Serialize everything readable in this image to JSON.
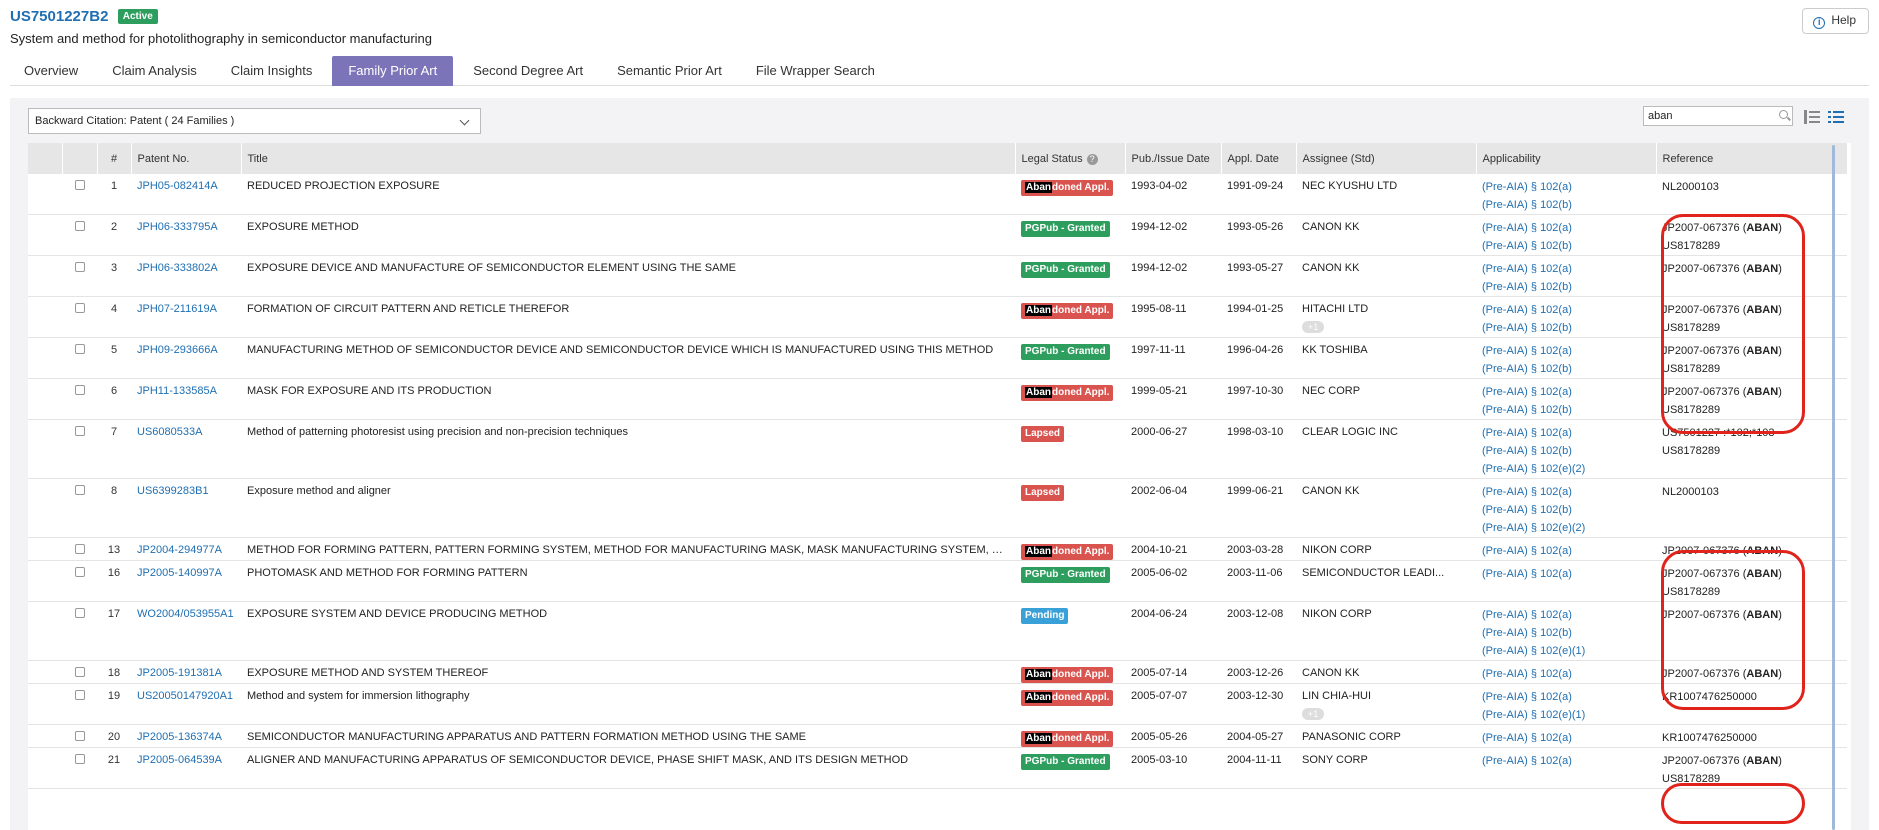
{
  "header": {
    "patent_id": "US7501227B2",
    "status": "Active",
    "title": "System and method for photolithography in semiconductor manufacturing",
    "help_label": "Help"
  },
  "tabs": [
    {
      "label": "Overview",
      "active": false
    },
    {
      "label": "Claim Analysis",
      "active": false
    },
    {
      "label": "Claim Insights",
      "active": false
    },
    {
      "label": "Family Prior Art",
      "active": true
    },
    {
      "label": "Second Degree Art",
      "active": false
    },
    {
      "label": "Semantic Prior Art",
      "active": false
    },
    {
      "label": "File Wrapper Search",
      "active": false
    }
  ],
  "filter": {
    "citation_select": "Backward Citation: Patent ( 24 Families )",
    "search_value": "aban"
  },
  "table": {
    "columns": [
      "#",
      "Patent No.",
      "Title",
      "Legal Status",
      "Pub./Issue Date",
      "Appl. Date",
      "Assignee (Std)",
      "Applicability",
      "Reference"
    ],
    "rows": [
      {
        "num": "1",
        "patent": "JPH05-082414A",
        "title": "REDUCED PROJECTION EXPOSURE",
        "status_type": "aban",
        "status_pre": "Aban",
        "status_post": "doned Appl.",
        "pub": "1993-04-02",
        "appl": "1991-09-24",
        "assignee": "NEC KYUSHU LTD",
        "plus": "",
        "applic": [
          "(Pre-AIA) § 102(a)",
          "(Pre-AIA) § 102(b)"
        ],
        "ref": [
          {
            "pre": "NL2000103",
            "bold": "",
            "post": ""
          }
        ]
      },
      {
        "num": "2",
        "patent": "JPH06-333795A",
        "title": "EXPOSURE METHOD",
        "status_type": "granted",
        "status_pre": "",
        "status_post": "PGPub - Granted",
        "pub": "1994-12-02",
        "appl": "1993-05-26",
        "assignee": "CANON KK",
        "plus": "",
        "applic": [
          "(Pre-AIA) § 102(a)",
          "(Pre-AIA) § 102(b)"
        ],
        "ref": [
          {
            "pre": "JP2007-067376 (",
            "bold": "ABAN",
            "post": ")"
          },
          {
            "pre": "US8178289",
            "bold": "",
            "post": ""
          }
        ]
      },
      {
        "num": "3",
        "patent": "JPH06-333802A",
        "title": "EXPOSURE DEVICE AND MANUFACTURE OF SEMICONDUCTOR ELEMENT USING THE SAME",
        "status_type": "granted",
        "status_pre": "",
        "status_post": "PGPub - Granted",
        "pub": "1994-12-02",
        "appl": "1993-05-27",
        "assignee": "CANON KK",
        "plus": "",
        "applic": [
          "(Pre-AIA) § 102(a)",
          "(Pre-AIA) § 102(b)"
        ],
        "ref": [
          {
            "pre": "JP2007-067376 (",
            "bold": "ABAN",
            "post": ")"
          }
        ]
      },
      {
        "num": "4",
        "patent": "JPH07-211619A",
        "title": "FORMATION OF CIRCUIT PATTERN AND RETICLE THEREFOR",
        "status_type": "aban",
        "status_pre": "Aban",
        "status_post": "doned Appl.",
        "pub": "1995-08-11",
        "appl": "1994-01-25",
        "assignee": "HITACHI LTD",
        "plus": "+1",
        "applic": [
          "(Pre-AIA) § 102(a)",
          "(Pre-AIA) § 102(b)"
        ],
        "ref": [
          {
            "pre": "JP2007-067376 (",
            "bold": "ABAN",
            "post": ")"
          },
          {
            "pre": "US8178289",
            "bold": "",
            "post": ""
          }
        ]
      },
      {
        "num": "5",
        "patent": "JPH09-293666A",
        "title": "MANUFACTURING METHOD OF SEMICONDUCTOR DEVICE AND SEMICONDUCTOR DEVICE WHICH IS MANUFACTURED USING THIS METHOD",
        "status_type": "granted",
        "status_pre": "",
        "status_post": "PGPub - Granted",
        "pub": "1997-11-11",
        "appl": "1996-04-26",
        "assignee": "KK TOSHIBA",
        "plus": "",
        "applic": [
          "(Pre-AIA) § 102(a)",
          "(Pre-AIA) § 102(b)"
        ],
        "ref": [
          {
            "pre": "JP2007-067376 (",
            "bold": "ABAN",
            "post": ")"
          },
          {
            "pre": "US8178289",
            "bold": "",
            "post": ""
          }
        ]
      },
      {
        "num": "6",
        "patent": "JPH11-133585A",
        "title": "MASK FOR EXPOSURE AND ITS PRODUCTION",
        "status_type": "aban",
        "status_pre": "Aban",
        "status_post": "doned Appl.",
        "pub": "1999-05-21",
        "appl": "1997-10-30",
        "assignee": "NEC CORP",
        "plus": "",
        "applic": [
          "(Pre-AIA) § 102(a)",
          "(Pre-AIA) § 102(b)"
        ],
        "ref": [
          {
            "pre": "JP2007-067376 (",
            "bold": "ABAN",
            "post": ")"
          },
          {
            "pre": "US8178289",
            "bold": "",
            "post": ""
          }
        ]
      },
      {
        "num": "7",
        "patent": "US6080533A",
        "title": "Method of patterning photoresist using precision and non-precision techniques",
        "status_type": "lapsed",
        "status_pre": "",
        "status_post": "Lapsed",
        "pub": "2000-06-27",
        "appl": "1998-03-10",
        "assignee": "CLEAR LOGIC INC",
        "plus": "",
        "applic": [
          "(Pre-AIA) § 102(a)",
          "(Pre-AIA) § 102(b)",
          "(Pre-AIA) § 102(e)(2)"
        ],
        "ref": [
          {
            "pre": "US7501227 :*102;*103",
            "bold": "",
            "post": ""
          },
          {
            "pre": "US8178289",
            "bold": "",
            "post": ""
          }
        ]
      },
      {
        "num": "8",
        "patent": "US6399283B1",
        "title": "Exposure method and aligner",
        "status_type": "lapsed",
        "status_pre": "",
        "status_post": "Lapsed",
        "pub": "2002-06-04",
        "appl": "1999-06-21",
        "assignee": "CANON KK",
        "plus": "",
        "applic": [
          "(Pre-AIA) § 102(a)",
          "(Pre-AIA) § 102(b)",
          "(Pre-AIA) § 102(e)(2)"
        ],
        "ref": [
          {
            "pre": "NL2000103",
            "bold": "",
            "post": ""
          }
        ]
      },
      {
        "num": "13",
        "patent": "JP2004-294977A",
        "title": "METHOD FOR FORMING PATTERN, PATTERN FORMING SYSTEM, METHOD FOR MANUFACTURING MASK, MASK MANUFACTURING SYSTEM, MASK, EXPOSURE METHOD",
        "status_type": "aban",
        "status_pre": "Aban",
        "status_post": "doned Appl.",
        "pub": "2004-10-21",
        "appl": "2003-03-28",
        "assignee": "NIKON CORP",
        "plus": "",
        "applic": [
          "(Pre-AIA) § 102(a)"
        ],
        "ref": [
          {
            "pre": "JP2007-067376 (",
            "bold": "ABAN",
            "post": ")"
          }
        ]
      },
      {
        "num": "16",
        "patent": "JP2005-140997A",
        "title": "PHOTOMASK AND METHOD FOR FORMING PATTERN",
        "status_type": "granted",
        "status_pre": "",
        "status_post": "PGPub - Granted",
        "pub": "2005-06-02",
        "appl": "2003-11-06",
        "assignee": "SEMICONDUCTOR LEADI...",
        "plus": "",
        "applic": [
          "(Pre-AIA) § 102(a)"
        ],
        "ref": [
          {
            "pre": "JP2007-067376 (",
            "bold": "ABAN",
            "post": ")"
          },
          {
            "pre": "US8178289",
            "bold": "",
            "post": ""
          }
        ]
      },
      {
        "num": "17",
        "patent": "WO2004/053955A1",
        "title": "EXPOSURE SYSTEM AND DEVICE PRODUCING METHOD",
        "status_type": "pending",
        "status_pre": "",
        "status_post": "Pending",
        "pub": "2004-06-24",
        "appl": "2003-12-08",
        "assignee": "NIKON CORP",
        "plus": "",
        "applic": [
          "(Pre-AIA) § 102(a)",
          "(Pre-AIA) § 102(b)",
          "(Pre-AIA) § 102(e)(1)"
        ],
        "ref": [
          {
            "pre": "JP2007-067376 (",
            "bold": "ABAN",
            "post": ")"
          }
        ]
      },
      {
        "num": "18",
        "patent": "JP2005-191381A",
        "title": "EXPOSURE METHOD AND SYSTEM THEREOF",
        "status_type": "aban",
        "status_pre": "Aban",
        "status_post": "doned Appl.",
        "pub": "2005-07-14",
        "appl": "2003-12-26",
        "assignee": "CANON KK",
        "plus": "",
        "applic": [
          "(Pre-AIA) § 102(a)"
        ],
        "ref": [
          {
            "pre": "JP2007-067376 (",
            "bold": "ABAN",
            "post": ")"
          }
        ]
      },
      {
        "num": "19",
        "patent": "US20050147920A1",
        "title": "Method and system for immersion lithography",
        "status_type": "aban",
        "status_pre": "Aban",
        "status_post": "doned Appl.",
        "pub": "2005-07-07",
        "appl": "2003-12-30",
        "assignee": "LIN CHIA-HUI",
        "plus": "+1",
        "applic": [
          "(Pre-AIA) § 102(a)",
          "(Pre-AIA) § 102(e)(1)"
        ],
        "ref": [
          {
            "pre": "KR1007476250000",
            "bold": "",
            "post": ""
          }
        ]
      },
      {
        "num": "20",
        "patent": "JP2005-136374A",
        "title": "SEMICONDUCTOR MANUFACTURING APPARATUS AND PATTERN FORMATION METHOD USING THE SAME",
        "status_type": "aban",
        "status_pre": "Aban",
        "status_post": "doned Appl.",
        "pub": "2005-05-26",
        "appl": "2004-05-27",
        "assignee": "PANASONIC CORP",
        "plus": "",
        "applic": [
          "(Pre-AIA) § 102(a)"
        ],
        "ref": [
          {
            "pre": "KR1007476250000",
            "bold": "",
            "post": ""
          }
        ]
      },
      {
        "num": "21",
        "patent": "JP2005-064539A",
        "title": "ALIGNER AND MANUFACTURING APPARATUS OF SEMICONDUCTOR DEVICE, PHASE SHIFT MASK, AND ITS DESIGN METHOD",
        "status_type": "granted",
        "status_pre": "",
        "status_post": "PGPub - Granted",
        "pub": "2005-03-10",
        "appl": "2004-11-11",
        "assignee": "SONY CORP",
        "plus": "",
        "applic": [
          "(Pre-AIA) § 102(a)"
        ],
        "ref": [
          {
            "pre": "JP2007-067376 (",
            "bold": "ABAN",
            "post": ")"
          },
          {
            "pre": "US8178289",
            "bold": "",
            "post": ""
          }
        ]
      }
    ]
  },
  "colors": {
    "accent_tab": "#7b74b8",
    "link": "#1f6fb2",
    "status_active": "#2e9e5e",
    "abandoned": "#d9534f",
    "granted": "#2e9e5e",
    "pending": "#3aa0d8",
    "annotation_circle": "#e0231b"
  }
}
